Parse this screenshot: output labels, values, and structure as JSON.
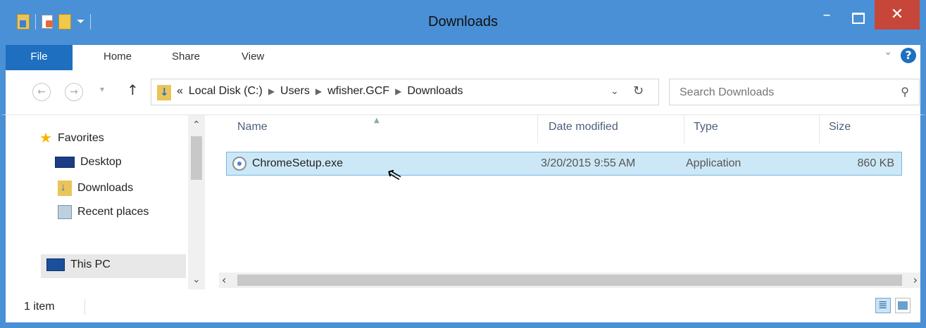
{
  "window": {
    "title": "Downloads",
    "minimize_label": "–",
    "close_label": "✕"
  },
  "ribbon": {
    "tabs": [
      {
        "label": "File"
      },
      {
        "label": "Home"
      },
      {
        "label": "Share"
      },
      {
        "label": "View"
      }
    ],
    "help_label": "?"
  },
  "address_bar": {
    "prefix": "«",
    "crumbs": [
      "Local Disk (C:)",
      "Users",
      "wfisher.GCF",
      "Downloads"
    ],
    "search_placeholder": "Search Downloads"
  },
  "nav_pane": {
    "favorites_label": "Favorites",
    "items": [
      {
        "label": "Desktop"
      },
      {
        "label": "Downloads"
      },
      {
        "label": "Recent places"
      }
    ],
    "this_pc_label": "This PC"
  },
  "file_list": {
    "columns": {
      "name": "Name",
      "date": "Date modified",
      "type": "Type",
      "size": "Size"
    },
    "rows": [
      {
        "name": "ChromeSetup.exe",
        "date": "3/20/2015 9:55 AM",
        "type": "Application",
        "size": "860 KB",
        "selected": true
      }
    ]
  },
  "status_bar": {
    "item_count": "1 item"
  },
  "colors": {
    "window_frame": "#4a90d6",
    "file_tab": "#1e6fc0",
    "close_button": "#c7463a",
    "selection": "#cce8f7"
  },
  "icons": {
    "favorites": "star-icon",
    "desktop": "desktop-icon",
    "downloads": "downloads-folder-icon",
    "recent": "recent-places-icon",
    "this_pc": "this-pc-icon",
    "file": "chrome-setup-icon"
  }
}
